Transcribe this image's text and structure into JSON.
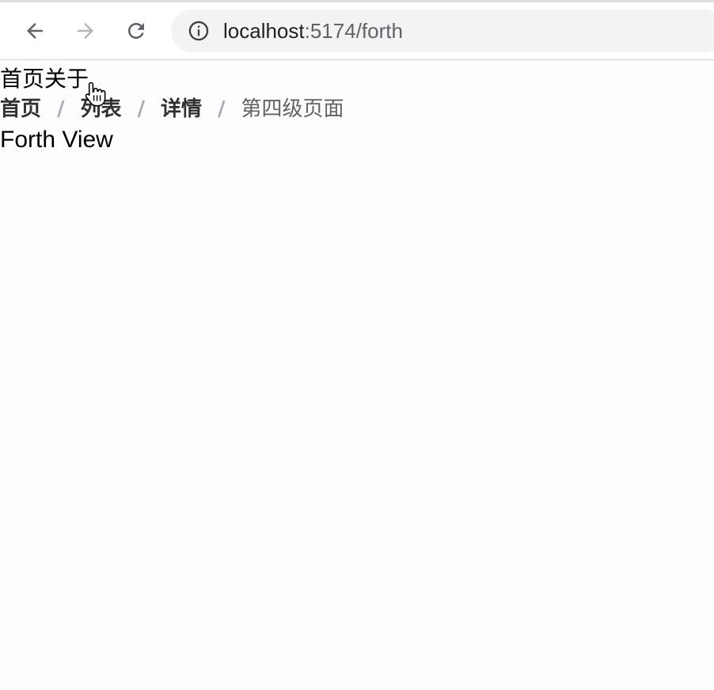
{
  "browser": {
    "url_host": "localhost",
    "url_path": ":5174/forth"
  },
  "nav": {
    "home_link": "首页",
    "about_link": "关于"
  },
  "breadcrumb": {
    "items": [
      "首页",
      "列表",
      "详情"
    ],
    "separator": "/",
    "current": "第四级页面"
  },
  "page": {
    "heading": "Forth View"
  },
  "colors": {
    "crumb_link": "#303133",
    "crumb_separator": "#a8abb2",
    "crumb_current": "#606266"
  }
}
